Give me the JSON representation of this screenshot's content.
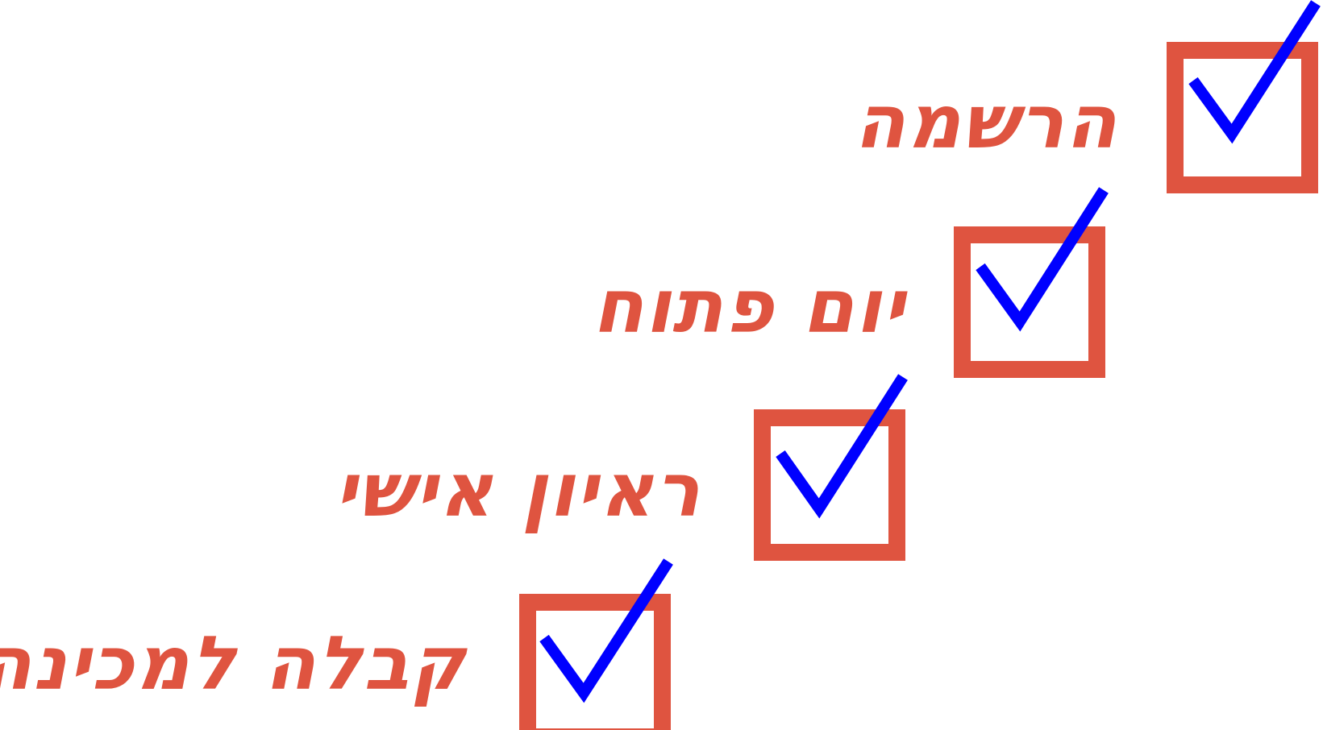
{
  "colors": {
    "accent": "#df5440",
    "check": "#0000ff",
    "background": "#ffffff"
  },
  "steps": [
    {
      "label": "הרשמה",
      "checked": true,
      "icon": "checkbox-checked-icon"
    },
    {
      "label": "יום פתוח",
      "checked": true,
      "icon": "checkbox-checked-icon"
    },
    {
      "label": "ראיון אישי",
      "checked": true,
      "icon": "checkbox-checked-icon"
    },
    {
      "label": "קבלה למכינה",
      "checked": true,
      "icon": "checkbox-checked-icon"
    }
  ]
}
